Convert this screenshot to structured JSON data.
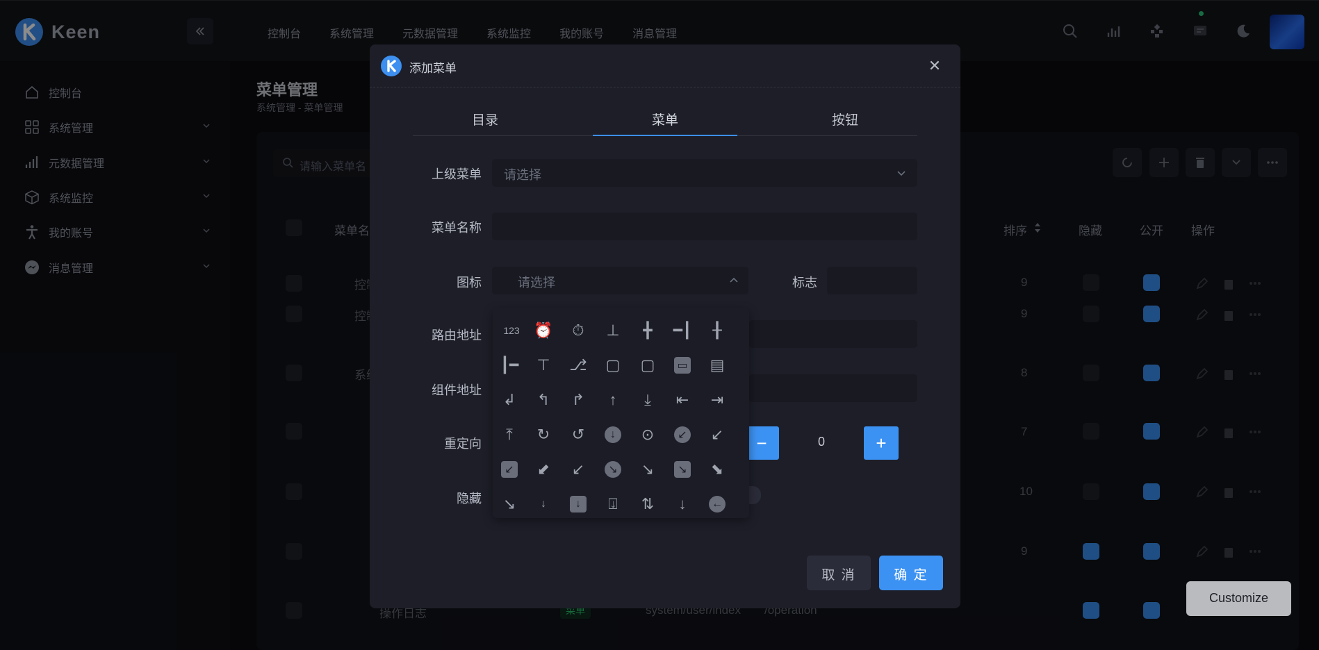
{
  "app": {
    "brand": "Keen"
  },
  "top_nav": [
    "控制台",
    "系统管理",
    "元数据管理",
    "系统监控",
    "我的账号",
    "消息管理"
  ],
  "sidebar": [
    {
      "label": "控制台",
      "icon": "home-icon"
    },
    {
      "label": "系统管理",
      "icon": "grid-icon"
    },
    {
      "label": "元数据管理",
      "icon": "bar-chart-icon"
    },
    {
      "label": "系统监控",
      "icon": "cube-icon"
    },
    {
      "label": "我的账号",
      "icon": "person-icon"
    },
    {
      "label": "消息管理",
      "icon": "messenger-icon"
    }
  ],
  "page": {
    "title": "菜单管理",
    "breadcrumb": "系统管理  -  菜单管理"
  },
  "table": {
    "search_placeholder": "请输入菜单名",
    "headers": {
      "name": "菜单名",
      "sort": "排序",
      "hidden": "隐藏",
      "public": "公开",
      "ops": "操作"
    },
    "rows": [
      {
        "name": "控制",
        "sort": "9",
        "hidden": false,
        "public": true
      },
      {
        "name": "控制",
        "sort": "9",
        "hidden": false,
        "public": true
      },
      {
        "name": "系统",
        "sort": "8",
        "hidden": false,
        "public": true
      },
      {
        "name": "",
        "sort": "7",
        "hidden": false,
        "public": true
      },
      {
        "name": "",
        "sort": "10",
        "hidden": false,
        "public": true
      },
      {
        "name": "",
        "sort": "9",
        "hidden": true,
        "public": true
      },
      {
        "name": "操作日志",
        "type": "菜单",
        "component": "system/user/index",
        "path": "/operation",
        "sort": "",
        "hidden": true,
        "public": true
      }
    ]
  },
  "modal": {
    "title": "添加菜单",
    "tabs": [
      "目录",
      "菜单",
      "按钮"
    ],
    "active_tab": "菜单",
    "fields": {
      "parent_label": "上级菜单",
      "parent_placeholder": "请选择",
      "name_label": "菜单名称",
      "icon_label": "图标",
      "icon_placeholder": "请选择",
      "flag_label": "标志",
      "route_label": "路由地址",
      "component_label": "组件地址",
      "redirect_label": "重定向",
      "hidden_label": "隐藏"
    },
    "stepper": {
      "value": "0",
      "minus": "−",
      "plus": "+"
    },
    "cancel": "取 消",
    "ok": "确 定"
  },
  "icon_picker": {
    "first_label": "123",
    "icons": [
      "123-icon",
      "alarm-fill-icon",
      "alarm-icon",
      "align-bottom-icon",
      "align-center-icon",
      "align-end-icon",
      "align-middle-icon",
      "align-start-icon",
      "align-top-icon",
      "alt-icon",
      "app-indicator-icon",
      "app-icon",
      "archive-fill-icon",
      "archive-icon",
      "arrow-90deg-down-icon",
      "arrow-90deg-left-icon",
      "arrow-90deg-right-icon",
      "arrow-90deg-up-icon",
      "arrow-bar-down-icon",
      "arrow-bar-left-icon",
      "arrow-bar-right-icon",
      "arrow-bar-up-icon",
      "arrow-clockwise-icon",
      "arrow-counterclockwise-icon",
      "arrow-down-circle-fill-icon",
      "arrow-down-circle-icon",
      "arrow-down-left-circle-fill-icon",
      "arrow-down-left-circle-icon",
      "arrow-down-left-square-fill-icon",
      "arrow-down-left-square-icon",
      "arrow-down-left-icon",
      "arrow-down-right-circle-fill-icon",
      "arrow-down-right-circle-icon",
      "arrow-down-right-square-fill-icon",
      "arrow-down-right-square-icon",
      "arrow-down-right-icon",
      "arrow-down-short-icon",
      "arrow-down-square-fill-icon",
      "arrow-down-square-icon",
      "arrow-down-up-icon",
      "arrow-down-icon",
      "arrow-left-circle-fill-icon"
    ]
  },
  "customize": "Customize"
}
